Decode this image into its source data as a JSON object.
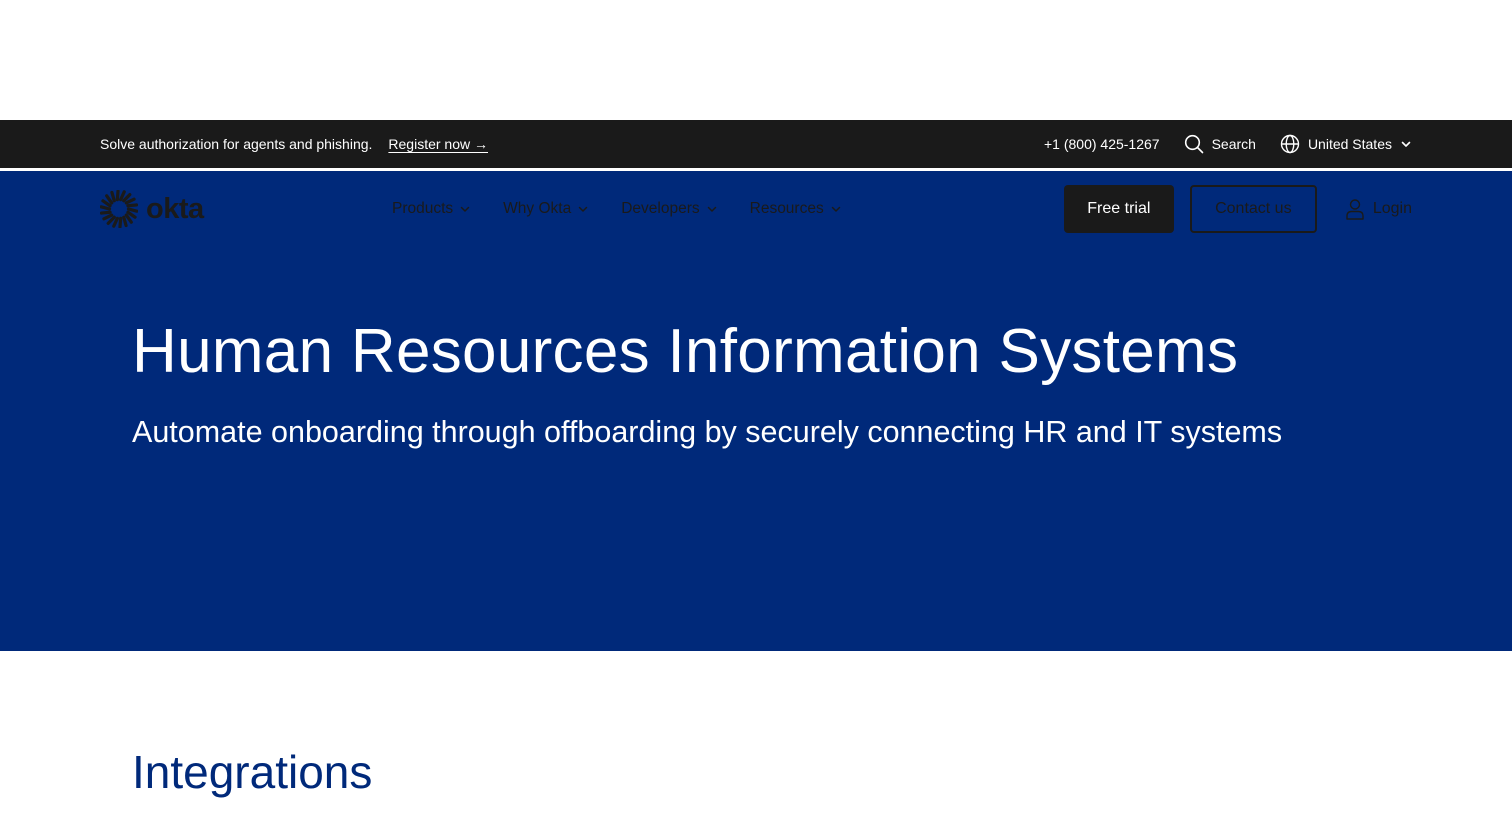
{
  "colors": {
    "brand_blue": "#00297a",
    "dark": "#1a1a1a",
    "white": "#ffffff"
  },
  "announcement": {
    "text": "Solve authorization for agents and phishing.",
    "link_label": "Register now →"
  },
  "utility": {
    "phone": "+1 (800) 425-1267",
    "search_label": "Search",
    "search_icon": "search-icon",
    "locale_label": "United States",
    "locale_icon": "globe-icon"
  },
  "nav": {
    "logo_text": "okta",
    "items": [
      {
        "label": "Products"
      },
      {
        "label": "Why Okta"
      },
      {
        "label": "Developers"
      },
      {
        "label": "Resources"
      }
    ],
    "free_trial_label": "Free trial",
    "contact_label": "Contact us",
    "login_label": "Login",
    "login_icon": "user-icon"
  },
  "hero": {
    "title": "Human Resources Information Systems",
    "subtitle": "Automate onboarding through offboarding by securely connecting HR and IT systems"
  },
  "section": {
    "title": "Integrations"
  }
}
